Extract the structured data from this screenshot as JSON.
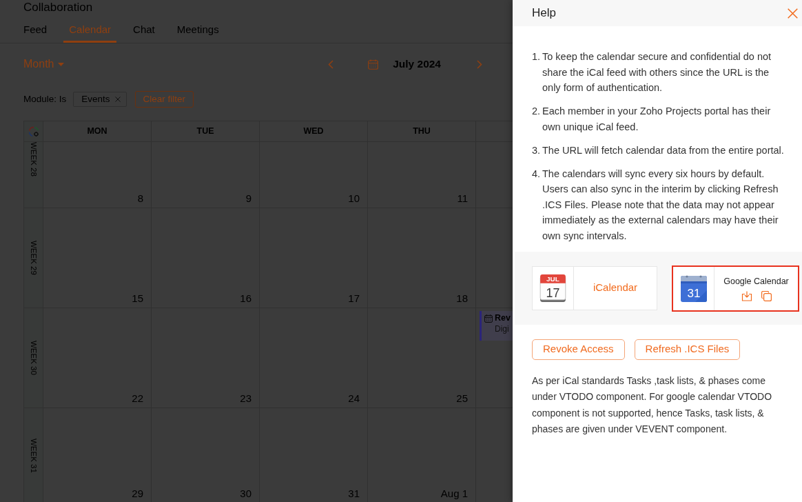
{
  "app": {
    "title": "Collaboration",
    "tabs": [
      {
        "label": "Feed",
        "selected": false
      },
      {
        "label": "Calendar",
        "selected": true
      },
      {
        "label": "Chat",
        "selected": false
      },
      {
        "label": "Meetings",
        "selected": false
      }
    ]
  },
  "toolbar": {
    "view": "Month",
    "period": "July 2024"
  },
  "filter": {
    "field": "Module: Is",
    "chips": [
      "Events"
    ],
    "clear": "Clear filter"
  },
  "calendar": {
    "columns": [
      "MON",
      "TUE",
      "WED",
      "THU"
    ],
    "weeks": [
      {
        "label": "WEEK 28",
        "days": [
          "8",
          "9",
          "10",
          "11"
        ]
      },
      {
        "label": "WEEK 29",
        "days": [
          "15",
          "16",
          "17",
          "18"
        ]
      },
      {
        "label": "WEEK 30",
        "days": [
          "22",
          "23",
          "24",
          "25"
        ],
        "events": [
          {
            "title": "Rev",
            "subtitle": "Digi"
          }
        ]
      },
      {
        "label": "WEEK 31",
        "days": [
          "29",
          "30",
          "31",
          "Aug 1"
        ]
      }
    ]
  },
  "help": {
    "title": "Help",
    "notes": [
      {
        "number": "1.",
        "text": "To keep the calendar secure and confidential do not share the iCal feed with others since the URL is the only form of authentication."
      },
      {
        "number": "2.",
        "text": "Each member in your Zoho Projects portal has their own unique iCal feed."
      },
      {
        "number": "3.",
        "text": "The URL will fetch calendar data from the entire portal."
      },
      {
        "number": "4.",
        "text": "The calendars will sync every six hours by default. Users can also sync in the interim by clicking Refresh .ICS Files. Please note that the data may not appear immediately as the external calendars may have their own sync intervals."
      }
    ],
    "integrations": [
      {
        "kind": "ical",
        "name": "iCalendar",
        "logo_month": "JUL",
        "logo_day": "17",
        "highlighted": false
      },
      {
        "kind": "google",
        "name": "Google Calendar",
        "logo_day": "31",
        "highlighted": true
      }
    ],
    "buttons": [
      "Revoke Access",
      "Refresh .ICS Files"
    ],
    "footnote": "As per iCal standards Tasks ,task lists, & phases come under VTODO component. For google calendar VTODO component is not supported, hence Tasks, task lists, & phases are given under VEVENT component."
  }
}
